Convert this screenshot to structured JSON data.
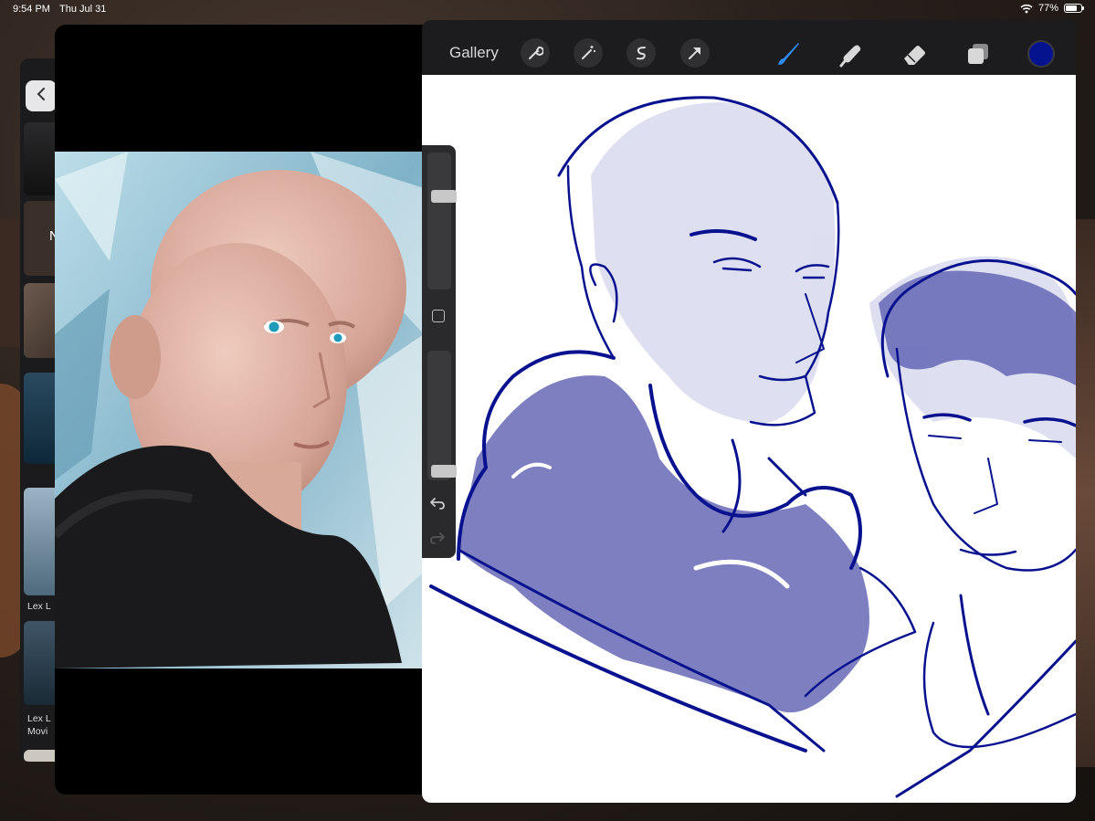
{
  "status_bar": {
    "time": "9:54 PM",
    "date": "Thu Jul 31",
    "battery_text": "77%",
    "battery_level": 0.77
  },
  "background_window": {
    "partial_text_1": "N",
    "caption_1": "Lex L",
    "caption_2_line1": "Lex L",
    "caption_2_line2": "Movi"
  },
  "procreate": {
    "gallery_label": "Gallery",
    "brush_color": "#06138f",
    "icons": [
      "wrench-icon",
      "magic-wand-icon",
      "selection-icon",
      "arrow-transform-icon",
      "brush-icon",
      "smudge-icon",
      "eraser-icon",
      "layers-icon"
    ],
    "brush_size_level": 0.15,
    "opacity_level": 0.98
  }
}
